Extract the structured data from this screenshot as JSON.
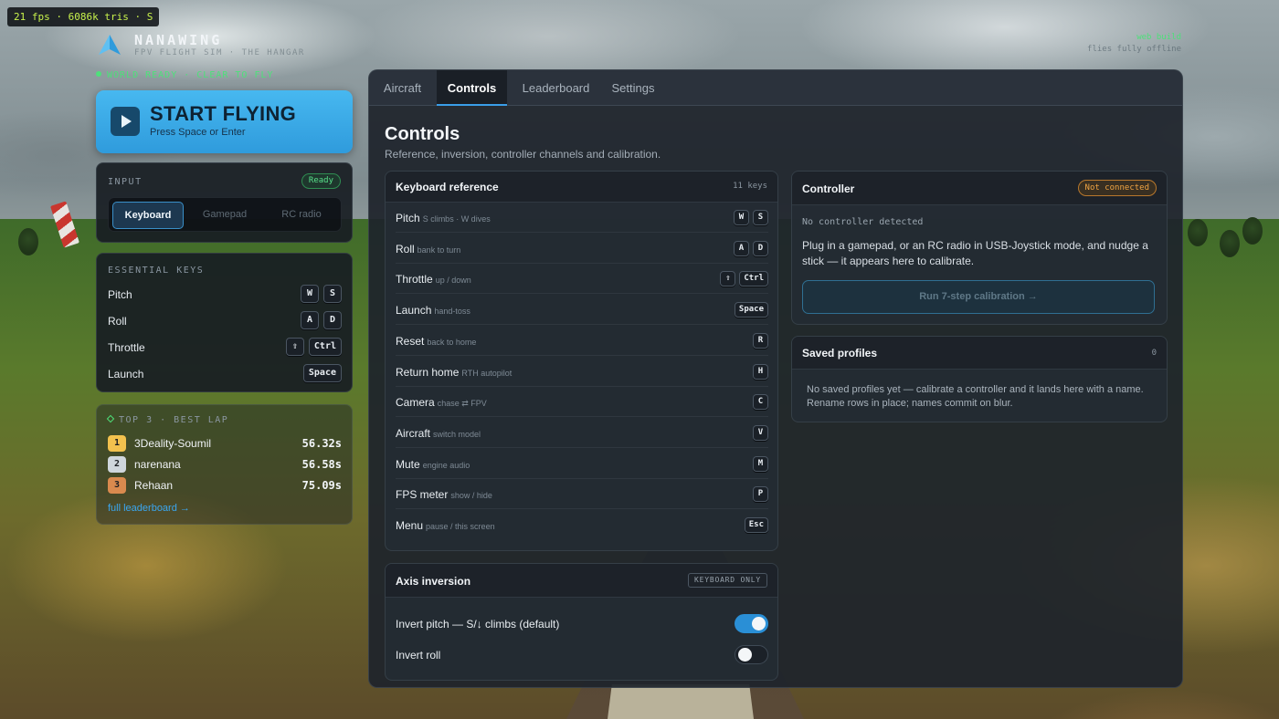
{
  "hud": {
    "fps_text": "21 fps · 6086k tris · S"
  },
  "brand": {
    "title": "NANAWING",
    "subtitle": "FPV FLIGHT SIM · THE HANGAR",
    "world_status": "WORLD READY · CLEAR TO FLY",
    "build_tag": "web build",
    "build_sub": "flies fully offline",
    "accent_color": "#3aa6f0"
  },
  "start": {
    "title": "START FLYING",
    "hint": "Press Space or Enter"
  },
  "input_panel": {
    "label": "INPUT",
    "status": "Ready",
    "modes": [
      "Keyboard",
      "Gamepad",
      "RC radio"
    ],
    "selected": "Keyboard"
  },
  "essential_keys": {
    "label": "ESSENTIAL KEYS",
    "rows": [
      {
        "label": "Pitch",
        "keys": [
          "W",
          "S"
        ]
      },
      {
        "label": "Roll",
        "keys": [
          "A",
          "D"
        ]
      },
      {
        "label": "Throttle",
        "keys": [
          "⇧",
          "Ctrl"
        ]
      },
      {
        "label": "Launch",
        "keys": [
          "Space"
        ]
      }
    ]
  },
  "leaderboard_preview": {
    "label": "TOP 3 · BEST LAP",
    "entries": [
      {
        "rank": "1",
        "name": "3Deality-Soumil",
        "time": "56.32s",
        "color": "#f2c14e"
      },
      {
        "rank": "2",
        "name": "narenana",
        "time": "56.58s",
        "color": "#cfd6dc"
      },
      {
        "rank": "3",
        "name": "Rehaan",
        "time": "75.09s",
        "color": "#d98a4e"
      }
    ],
    "link": "full leaderboard →"
  },
  "tabs": [
    "Aircraft",
    "Controls",
    "Leaderboard",
    "Settings"
  ],
  "active_tab": "Controls",
  "page": {
    "title": "Controls",
    "subtitle": "Reference, inversion, controller channels and calibration."
  },
  "keyboard_reference": {
    "title": "Keyboard reference",
    "count": "11 keys",
    "rows": [
      {
        "name": "Pitch",
        "hint": "S climbs · W dives",
        "keys": [
          "W",
          "S"
        ]
      },
      {
        "name": "Roll",
        "hint": "bank to turn",
        "keys": [
          "A",
          "D"
        ]
      },
      {
        "name": "Throttle",
        "hint": "up / down",
        "keys": [
          "⇧",
          "Ctrl"
        ]
      },
      {
        "name": "Launch",
        "hint": "hand-toss",
        "keys": [
          "Space"
        ]
      },
      {
        "name": "Reset",
        "hint": "back to home",
        "keys": [
          "R"
        ]
      },
      {
        "name": "Return home",
        "hint": "RTH autopilot",
        "keys": [
          "H"
        ]
      },
      {
        "name": "Camera",
        "hint": "chase ⇄ FPV",
        "keys": [
          "C"
        ]
      },
      {
        "name": "Aircraft",
        "hint": "switch model",
        "keys": [
          "V"
        ]
      },
      {
        "name": "Mute",
        "hint": "engine audio",
        "keys": [
          "M"
        ]
      },
      {
        "name": "FPS meter",
        "hint": "show / hide",
        "keys": [
          "P"
        ]
      },
      {
        "name": "Menu",
        "hint": "pause / this screen",
        "keys": [
          "Esc"
        ]
      }
    ]
  },
  "axis_inversion": {
    "title": "Axis inversion",
    "badge": "KEYBOARD ONLY",
    "rows": [
      {
        "label": "Invert pitch — S/↓ climbs (default)",
        "on": true
      },
      {
        "label": "Invert roll",
        "on": false
      }
    ]
  },
  "controller": {
    "title": "Controller",
    "status": "Not connected",
    "detected_text": "No controller detected",
    "body": "Plug in a gamepad, or an RC radio in USB-Joystick mode, and nudge a stick — it appears here to calibrate.",
    "button": "Run 7-step calibration →"
  },
  "saved_profiles": {
    "title": "Saved profiles",
    "count": "0",
    "empty_text": "No saved profiles yet — calibrate a controller and it lands here with a name. Rename rows in place; names commit on blur."
  }
}
